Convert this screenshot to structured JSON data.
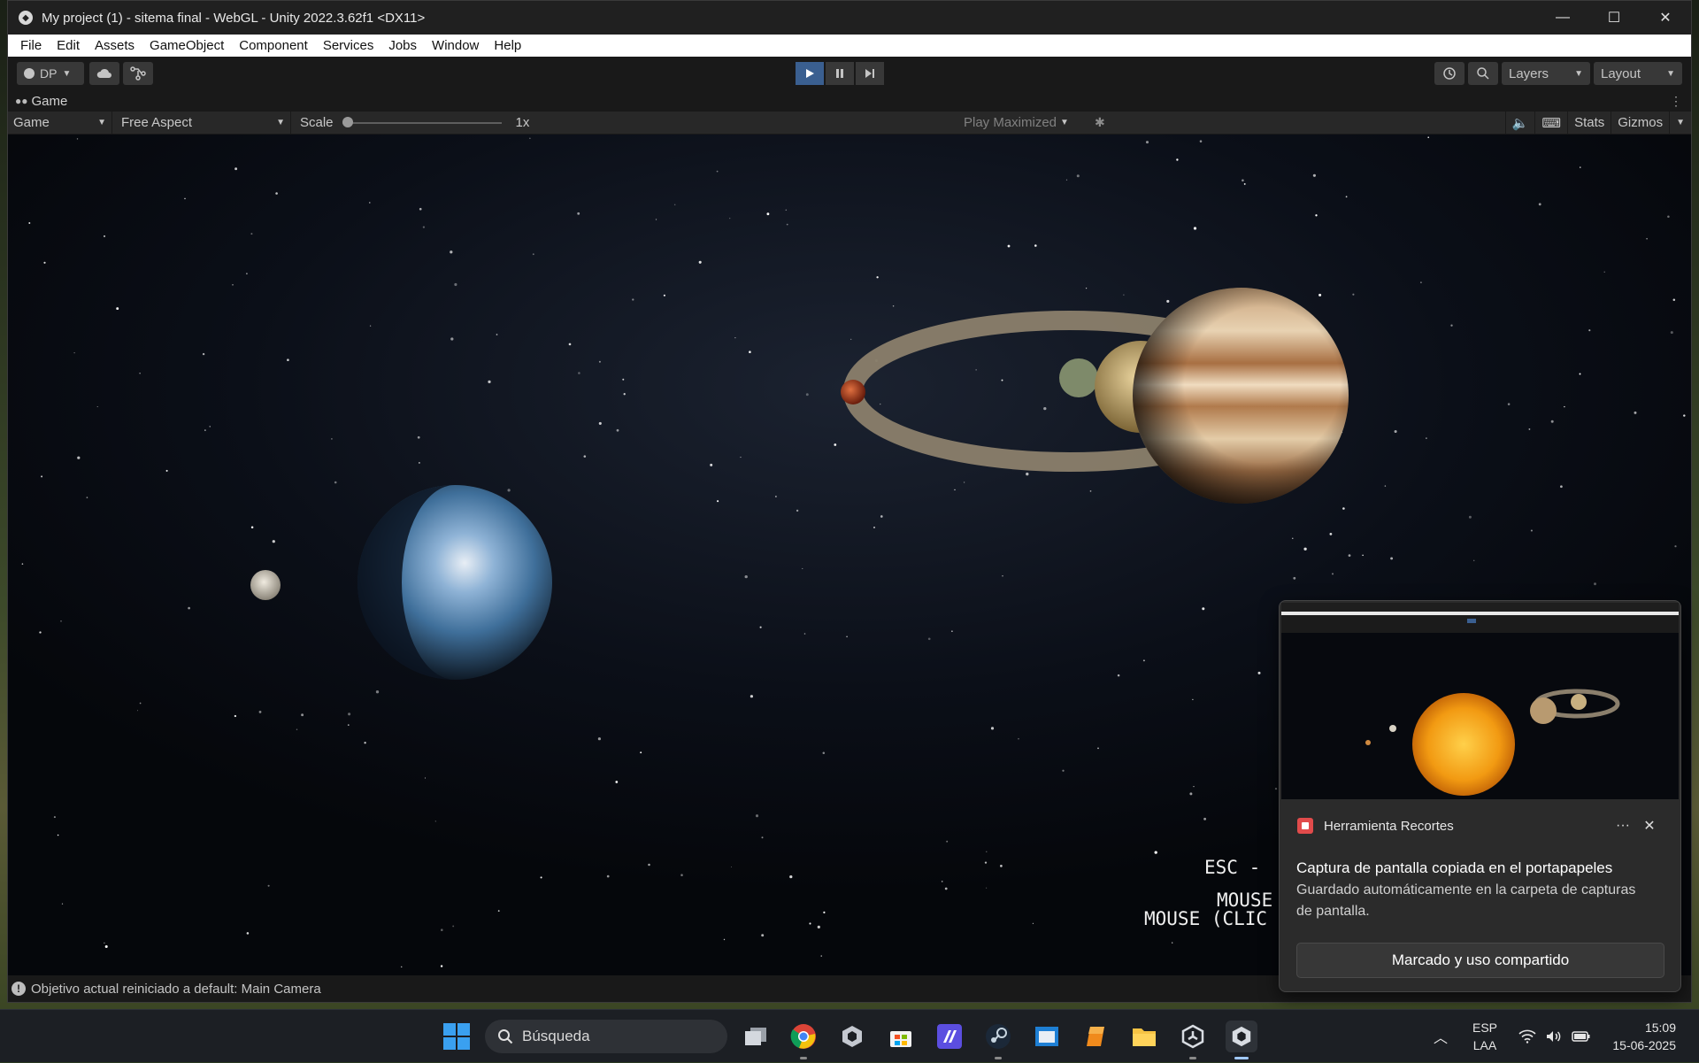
{
  "window": {
    "title": "My project (1) - sitema final - WebGL - Unity 2022.3.62f1 <DX11>",
    "minimize": "—",
    "maximize": "☐",
    "close": "✕"
  },
  "menu": [
    "File",
    "Edit",
    "Assets",
    "GameObject",
    "Component",
    "Services",
    "Jobs",
    "Window",
    "Help"
  ],
  "toolbar": {
    "account": "DP",
    "layers": "Layers",
    "layout": "Layout"
  },
  "tab": {
    "label": "Game"
  },
  "game_toolbar": {
    "display": "Game",
    "aspect": "Free Aspect",
    "scale_label": "Scale",
    "scale_value": "1x",
    "scale_fraction": 0.0,
    "play_mode": "Play Maximized",
    "stats": "Stats",
    "gizmos": "Gizmos"
  },
  "hud": {
    "line1": "ESC - ",
    "line2": "MOUSE",
    "line3": "MOUSE (CLIC"
  },
  "status": {
    "message": "Objetivo actual reiniciado a default: Main Camera"
  },
  "toast": {
    "app_name": "Herramienta Recortes",
    "more": "···",
    "close": "✕",
    "title": "Captura de pantalla copiada en el portapapeles",
    "body": "Guardado automáticamente en la carpeta de capturas de pantalla.",
    "action": "Marcado y uso compartido"
  },
  "taskbar": {
    "search_placeholder": "Búsqueda",
    "language_top": "ESP",
    "language_bottom": "LAA",
    "time": "15:09",
    "date": "15-06-2025"
  }
}
